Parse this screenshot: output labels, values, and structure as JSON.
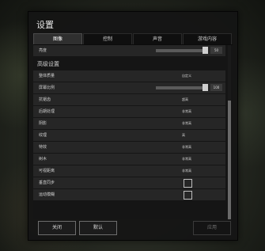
{
  "window": {
    "title": "设置"
  },
  "tabs": [
    {
      "label": "图像",
      "active": true
    },
    {
      "label": "控制",
      "active": false
    },
    {
      "label": "声音",
      "active": false
    },
    {
      "label": "游戏内容",
      "active": false
    }
  ],
  "top_row": {
    "label": "亮度",
    "value": "50"
  },
  "section": {
    "title": "高级设置"
  },
  "rows": [
    {
      "label": "整体质量",
      "value": "自定义"
    },
    {
      "label": "屏幕比例",
      "value": "100"
    },
    {
      "label": "抗锯齿",
      "value": "超高"
    },
    {
      "label": "后期处理",
      "value": "非常高"
    },
    {
      "label": "阴影",
      "value": "非常高"
    },
    {
      "label": "纹理",
      "value": "高"
    },
    {
      "label": "特效",
      "value": "非常高"
    },
    {
      "label": "树木",
      "value": "非常高"
    },
    {
      "label": "可视距离",
      "value": "非常高"
    },
    {
      "label": "垂直同步",
      "value": ""
    },
    {
      "label": "运动模糊",
      "value": ""
    }
  ],
  "buttons": {
    "close": "关闭",
    "defaults": "默认",
    "apply": "应用"
  },
  "colors": {
    "panel": "#141414",
    "row": "#262626",
    "active_tab": "#2f2f2f"
  }
}
